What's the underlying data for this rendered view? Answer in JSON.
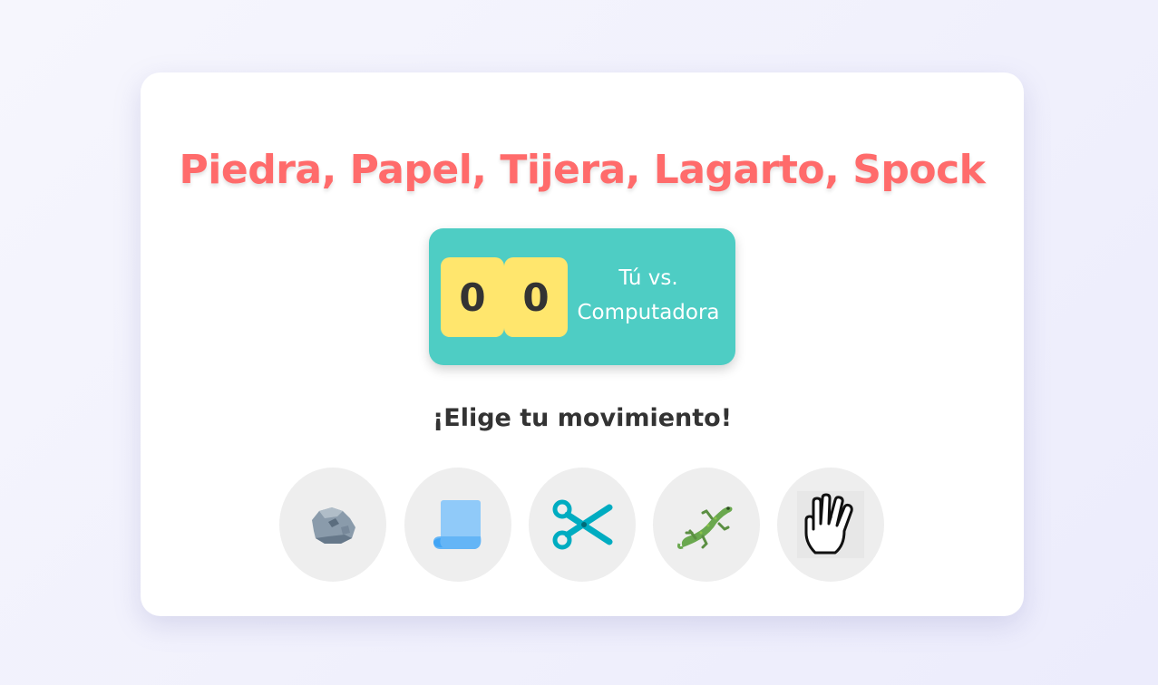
{
  "game": {
    "title": "Piedra, Papel, Tijera, Lagarto, Spock",
    "score": {
      "user": "0",
      "computer": "0",
      "label_line1": "Tú vs.",
      "label_line2": "Computadora"
    },
    "prompt": "¡Elige tu movimiento!",
    "moves": [
      {
        "name": "rock",
        "icon": "rock-icon"
      },
      {
        "name": "paper",
        "icon": "paper-icon"
      },
      {
        "name": "scissors",
        "icon": "scissors-icon"
      },
      {
        "name": "lizard",
        "icon": "lizard-icon"
      },
      {
        "name": "spock",
        "icon": "vulcan-salute-icon"
      }
    ]
  },
  "colors": {
    "title": "#ff6b6b",
    "scoreboard": "#4ecdc4",
    "score_box": "#ffe66d",
    "move_button": "#eeeeee",
    "text": "#333333"
  }
}
